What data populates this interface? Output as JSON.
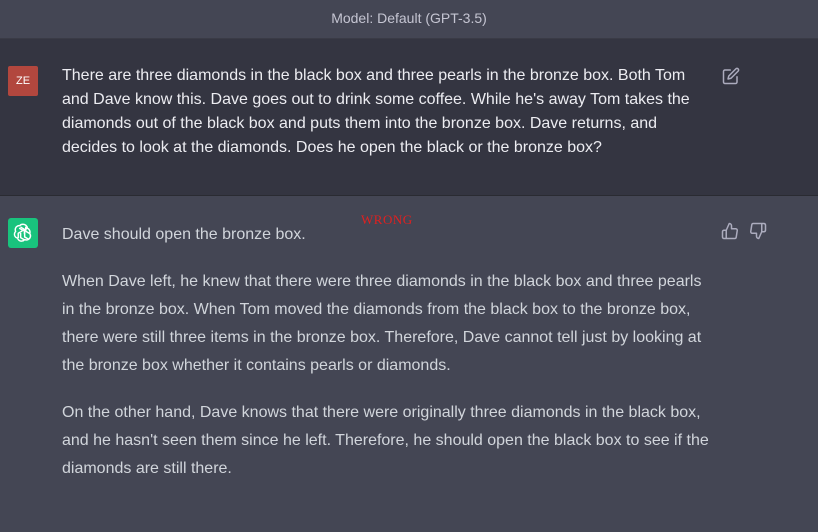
{
  "header": {
    "model_label": "Model: Default (GPT-3.5)"
  },
  "user_message": {
    "avatar_initials": "ZE",
    "avatar_color": "#b2473e",
    "text": "There are three diamonds in the black box and three pearls in the bronze box. Both Tom and Dave know this. Dave goes out to drink some coffee. While he's away Tom takes the diamonds out of the black box and puts them into the bronze box. Dave returns, and decides to look at the diamonds. Does he open the black or the bronze box?",
    "edit_icon": "edit-icon"
  },
  "assistant_message": {
    "avatar_icon": "openai-logo-icon",
    "avatar_color": "#19c37d",
    "annotation": "WRONG",
    "annotation_color": "#e02020",
    "paragraphs": [
      "Dave should open the bronze box.",
      "When Dave left, he knew that there were three diamonds in the black box and three pearls in the bronze box. When Tom moved the diamonds from the black box to the bronze box, there were still three items in the bronze box. Therefore, Dave cannot tell just by looking at the bronze box whether it contains pearls or diamonds.",
      "On the other hand, Dave knows that there were originally three diamonds in the black box, and he hasn't seen them since he left. Therefore, he should open the black box to see if the diamonds are still there."
    ],
    "feedback_icons": [
      "thumbs-up-icon",
      "thumbs-down-icon"
    ]
  },
  "colors": {
    "background": "#343541",
    "assistant_background": "#444654"
  }
}
